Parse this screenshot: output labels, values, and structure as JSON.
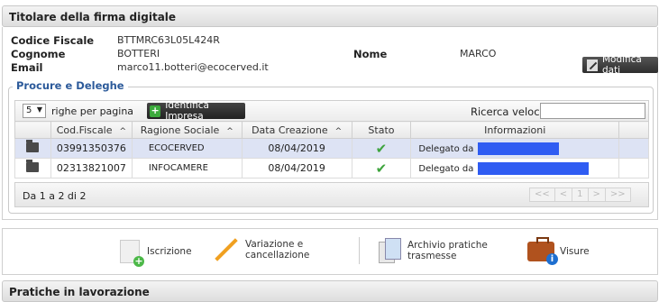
{
  "sections": {
    "titolare": "Titolare della firma digitale",
    "pratiche": "Pratiche in lavorazione"
  },
  "titolare": {
    "codice_fiscale_label": "Codice Fiscale",
    "codice_fiscale": "BTTMRC63L05L424R",
    "cognome_label": "Cognome",
    "cognome": "BOTTERI",
    "email_label": "Email",
    "email": "marco11.botteri@ecocerved.it",
    "nome_label": "Nome",
    "nome": "MARCO",
    "modifica_label": "Modifica dati"
  },
  "procure": {
    "legend": "Procure e Deleghe",
    "rows_per_page": "5",
    "rows_per_page_label": "righe per pagina",
    "identifica_label": "Identifica Impresa",
    "search_label": "Ricerca veloce",
    "search_value": "",
    "columns": [
      "Cod.Fiscale",
      "Ragione Sociale",
      "Data Creazione",
      "Stato",
      "Informazioni"
    ],
    "rows": [
      {
        "cod_fiscale": "03991350376",
        "ragione_sociale": "ECOCERVED",
        "data": "08/04/2019",
        "info": "Delegato da"
      },
      {
        "cod_fiscale": "02313821007",
        "ragione_sociale": "INFOCAMERE",
        "data": "08/04/2019",
        "info": "Delegato da"
      }
    ],
    "pager_info": "Da 1 a 2 di 2",
    "pager": [
      "<<",
      "<",
      "1",
      ">",
      ">>"
    ]
  },
  "actions": {
    "iscrizione": "Iscrizione",
    "variazione_1": "Variazione e",
    "variazione_2": "cancellazione",
    "archivio_1": "Archivio pratiche",
    "archivio_2": "trasmesse",
    "visure": "Visure"
  },
  "colors": {
    "legend": "#2c5a9a",
    "selected_row": "#dde3f4",
    "redaction": "#2f5cf2",
    "success": "#3ea43e"
  }
}
